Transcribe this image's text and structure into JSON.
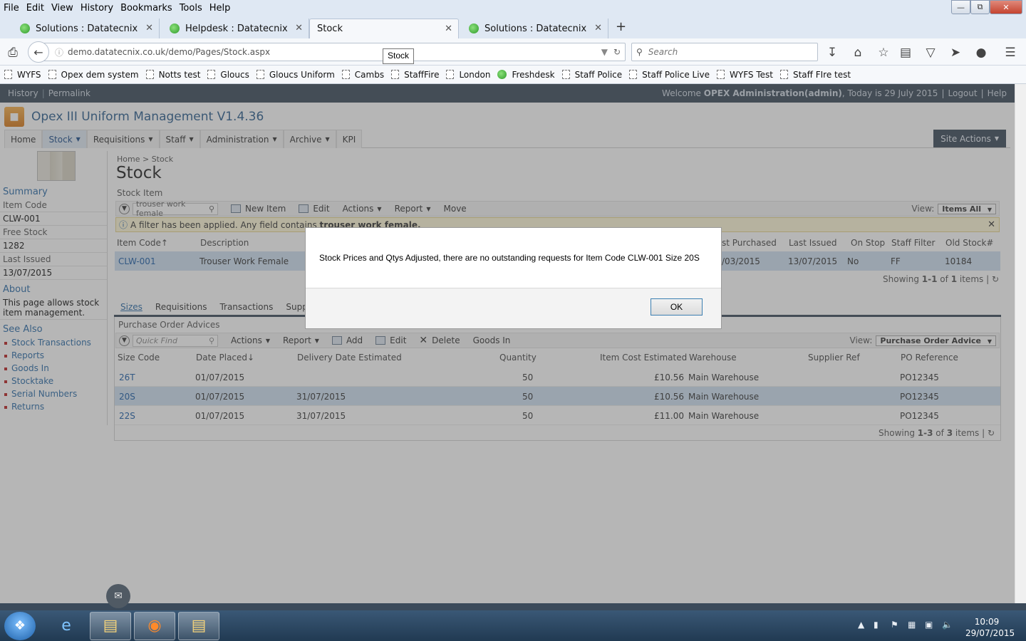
{
  "browser": {
    "menu": [
      "File",
      "Edit",
      "View",
      "History",
      "Bookmarks",
      "Tools",
      "Help"
    ],
    "tabs": [
      {
        "label": "Solutions : Datatecnix"
      },
      {
        "label": "Helpdesk : Datatecnix"
      },
      {
        "label": "Stock"
      },
      {
        "label": "Solutions : Datatecnix"
      }
    ],
    "url": "demo.datatecnix.co.uk/demo/Pages/Stock.aspx",
    "search_placeholder": "Search",
    "tooltip": "Stock",
    "bookmarks": [
      "WYFS",
      "Opex dem system",
      "Notts test",
      "Gloucs",
      "Gloucs Uniform",
      "Cambs",
      "StaffFire",
      "London",
      "Freshdesk",
      "Staff Police",
      "Staff Police Live",
      "WYFS Test",
      "Staff FIre test"
    ]
  },
  "app": {
    "top_left": [
      "History",
      "Permalink"
    ],
    "welcome": "Welcome",
    "user": "OPEX Administration(admin)",
    "today": ", Today is 29 July 2015",
    "logout": "Logout",
    "help": "Help",
    "title": "Opex III Uniform Management V1.4.36",
    "nav": [
      "Home",
      "Stock",
      "Requisitions",
      "Staff",
      "Administration",
      "Archive",
      "KPI"
    ],
    "site_actions": "Site Actions"
  },
  "breadcrumb": {
    "home": "Home",
    "sep": ">",
    "current": "Stock"
  },
  "page_title": "Stock",
  "left": {
    "summary": "Summary",
    "item_code_label": "Item Code",
    "item_code": "CLW-001",
    "free_stock_label": "Free Stock",
    "free_stock": "1282",
    "last_issued_label": "Last Issued",
    "last_issued": "13/07/2015",
    "about": "About",
    "about_text": "This page allows stock item management.",
    "see_also": "See Also",
    "links": [
      "Stock Transactions",
      "Reports",
      "Goods In",
      "Stocktake",
      "Serial Numbers",
      "Returns"
    ]
  },
  "stock_item": {
    "section": "Stock Item",
    "filter_value": "trouser work female",
    "toolbar": [
      "New Item",
      "Edit",
      "Actions",
      "Report",
      "Move"
    ],
    "view_label": "View:",
    "view": "Items All",
    "filter_msg": "A filter has been applied. Any field contains",
    "filter_term": "trouser work female.",
    "headers": [
      "Item Code",
      "Description",
      "st Purchased",
      "Last Issued",
      "On Stop",
      "Staff Filter",
      "Old Stock#"
    ],
    "row": [
      "CLW-001",
      "Trouser Work Female",
      "/03/2015",
      "13/07/2015",
      "No",
      "FF",
      "10184"
    ],
    "showing": "Showing",
    "range": "1-1",
    "of": "of",
    "count": "1",
    "items": "items"
  },
  "details": {
    "tabs": [
      "Sizes",
      "Requisitions",
      "Transactions",
      "Suppli"
    ],
    "section": "Purchase Order Advices",
    "quick_find": "Quick Find",
    "toolbar": [
      "Actions",
      "Report",
      "Add",
      "Edit",
      "Delete",
      "Goods In"
    ],
    "view_label": "View:",
    "view": "Purchase Order Advice",
    "headers": [
      "Size Code",
      "Date Placed",
      "Delivery Date Estimated",
      "Quantity",
      "Item Cost Estimated",
      "Warehouse",
      "Supplier Ref",
      "PO Reference"
    ],
    "rows": [
      [
        "26T",
        "01/07/2015",
        "",
        "50",
        "£10.56",
        "Main Warehouse",
        "",
        "PO12345"
      ],
      [
        "20S",
        "01/07/2015",
        "31/07/2015",
        "50",
        "£10.56",
        "Main Warehouse",
        "",
        "PO12345"
      ],
      [
        "22S",
        "01/07/2015",
        "31/07/2015",
        "50",
        "£11.00",
        "Main Warehouse",
        "",
        "PO12345"
      ]
    ],
    "showing": "Showing",
    "range": "1-3",
    "of": "of",
    "count": "3",
    "items": "items"
  },
  "dialog": {
    "message": "Stock Prices and Qtys Adjusted, there are no outstanding requests for Item Code CLW-001 Size 20S",
    "ok": "OK"
  },
  "taskbar": {
    "time": "10:09",
    "date": "29/07/2015"
  }
}
